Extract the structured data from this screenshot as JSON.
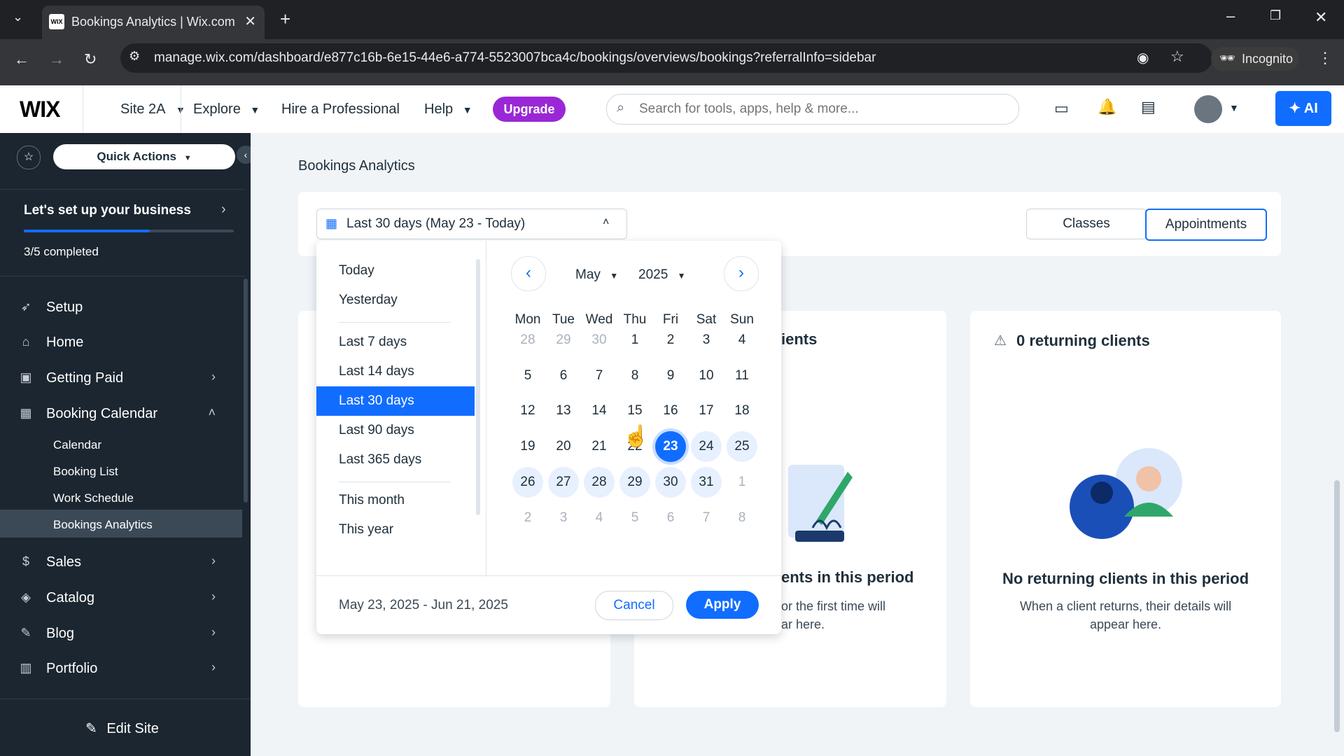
{
  "browser": {
    "tab_title": "Bookings Analytics | Wix.com",
    "favicon_text": "WIX",
    "url": "manage.wix.com/dashboard/e877c16b-6e15-44e6-a774-5523007bca4c/bookings/overviews/bookings?referralInfo=sidebar",
    "incognito_label": "Incognito"
  },
  "header": {
    "logo": "WIX",
    "site_name": "Site 2A",
    "explore": "Explore",
    "hire": "Hire a Professional",
    "help": "Help",
    "upgrade": "Upgrade",
    "search_placeholder": "Search for tools, apps, help & more...",
    "ai_label": "AI"
  },
  "sidebar": {
    "quick_actions": "Quick Actions",
    "setup_title": "Let's set up your business",
    "setup_progress": "3/5 completed",
    "setup_fraction": 0.6,
    "items": [
      {
        "label": "Setup",
        "icon": "rocket-icon"
      },
      {
        "label": "Home",
        "icon": "home-icon"
      },
      {
        "label": "Getting Paid",
        "icon": "getting-paid-icon"
      },
      {
        "label": "Booking Calendar",
        "icon": "calendar-icon"
      },
      {
        "label": "Sales",
        "icon": "dollar-icon"
      },
      {
        "label": "Catalog",
        "icon": "catalog-icon"
      },
      {
        "label": "Blog",
        "icon": "pen-icon"
      },
      {
        "label": "Portfolio",
        "icon": "portfolio-icon"
      }
    ],
    "sub_items": [
      "Calendar",
      "Booking List",
      "Work Schedule",
      "Bookings Analytics"
    ],
    "edit_site": "Edit Site"
  },
  "main": {
    "page_title": "Bookings Analytics",
    "date_range_label": "Last 30 days (May 23 - Today)",
    "tabs": [
      "Classes",
      "Appointments"
    ],
    "active_tab": "Appointments",
    "card_new_title_partial": "ients",
    "card_new_empty_partial": "ents in this period",
    "card_new_desc_line1_partial": "or the first time will",
    "card_new_desc_line2_partial": "ar here.",
    "returning": {
      "title": "0 returning clients",
      "empty_title": "No returning clients in this period",
      "empty_desc_line1": "When a client returns, their details will",
      "empty_desc_line2": "appear here."
    }
  },
  "datepicker": {
    "presets": [
      "Today",
      "Yesterday",
      "Last 7 days",
      "Last 14 days",
      "Last 30 days",
      "Last 90 days",
      "Last 365 days",
      "This month",
      "This year"
    ],
    "active_preset": "Last 30 days",
    "month": "May",
    "year": "2025",
    "weekdays": [
      "Mon",
      "Tue",
      "Wed",
      "Thu",
      "Fri",
      "Sat",
      "Sun"
    ],
    "weeks": [
      [
        "28",
        "29",
        "30",
        "1",
        "2",
        "3",
        "4"
      ],
      [
        "5",
        "6",
        "7",
        "8",
        "9",
        "10",
        "11"
      ],
      [
        "12",
        "13",
        "14",
        "15",
        "16",
        "17",
        "18"
      ],
      [
        "19",
        "20",
        "21",
        "22",
        "23",
        "24",
        "25"
      ],
      [
        "26",
        "27",
        "28",
        "29",
        "30",
        "31",
        "1"
      ],
      [
        "2",
        "3",
        "4",
        "5",
        "6",
        "7",
        "8"
      ]
    ],
    "selected_day": "23",
    "range_text": "May 23, 2025 - Jun 21, 2025",
    "cancel": "Cancel",
    "apply": "Apply"
  }
}
